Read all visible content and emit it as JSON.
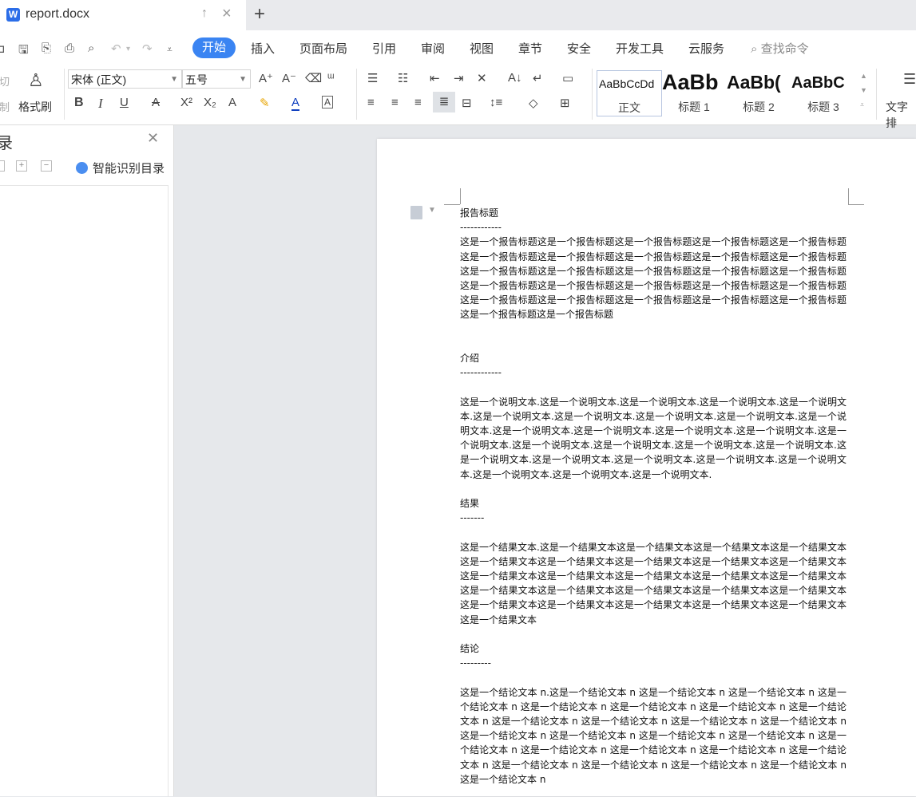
{
  "tab": {
    "app_icon": "W",
    "title": "report.docx",
    "new_tab": "+"
  },
  "menu": {
    "tabs": [
      "开始",
      "插入",
      "页面布局",
      "引用",
      "审阅",
      "视图",
      "章节",
      "安全",
      "开发工具",
      "云服务"
    ],
    "search": "查找命令"
  },
  "ribbon": {
    "cut": "切",
    "copy": "制",
    "format_painter": "格式刷",
    "font_name": "宋体 (正文)",
    "font_size": "五号",
    "styles": [
      {
        "sample": "AaBbCcDd",
        "name": "正文"
      },
      {
        "sample": "AaBb",
        "name": "标题 1"
      },
      {
        "sample": "AaBb(",
        "name": "标题 2"
      },
      {
        "sample": "AaBbC",
        "name": "标题 3"
      }
    ],
    "text_layout": "文字排"
  },
  "nav": {
    "title": "录",
    "smart_toc": "智能识别目录"
  },
  "document": {
    "h1": "报告标题",
    "h1_rule": "------------",
    "p1": "这是一个报告标题这是一个报告标题这是一个报告标题这是一个报告标题这是一个报告标题这是一个报告标题这是一个报告标题这是一个报告标题这是一个报告标题这是一个报告标题这是一个报告标题这是一个报告标题这是一个报告标题这是一个报告标题这是一个报告标题这是一个报告标题这是一个报告标题这是一个报告标题这是一个报告标题这是一个报告标题这是一个报告标题这是一个报告标题这是一个报告标题这是一个报告标题这是一个报告标题这是一个报告标题这是一个报告标题",
    "h2": "介绍",
    "h2_rule": "------------",
    "p2": "这是一个说明文本.这是一个说明文本.这是一个说明文本.这是一个说明文本.这是一个说明文本.这是一个说明文本.这是一个说明文本.这是一个说明文本.这是一个说明文本.这是一个说明文本.这是一个说明文本.这是一个说明文本.这是一个说明文本.这是一个说明文本.这是一个说明文本.这是一个说明文本.这是一个说明文本.这是一个说明文本.这是一个说明文本.这是一个说明文本.这是一个说明文本.这是一个说明文本.这是一个说明文本.这是一个说明文本.这是一个说明文本.这是一个说明文本.这是一个说明文本.",
    "h3": "结果",
    "h3_rule": "-------",
    "p3": "这是一个结果文本.这是一个结果文本这是一个结果文本这是一个结果文本这是一个结果文本这是一个结果文本这是一个结果文本这是一个结果文本这是一个结果文本这是一个结果文本这是一个结果文本这是一个结果文本这是一个结果文本这是一个结果文本这是一个结果文本这是一个结果文本这是一个结果文本这是一个结果文本这是一个结果文本这是一个结果文本这是一个结果文本这是一个结果文本这是一个结果文本这是一个结果文本这是一个结果文本这是一个结果文本",
    "h4": "结论",
    "h4_rule": "---------",
    "p4": "这是一个结论文本 n.这是一个结论文本 n 这是一个结论文本 n 这是一个结论文本 n 这是一个结论文本 n 这是一个结论文本 n 这是一个结论文本 n 这是一个结论文本 n 这是一个结论文本 n 这是一个结论文本 n 这是一个结论文本 n 这是一个结论文本 n 这是一个结论文本 n 这是一个结论文本 n 这是一个结论文本 n 这是一个结论文本 n 这是一个结论文本 n 这是一个结论文本 n 这是一个结论文本 n 这是一个结论文本 n 这是一个结论文本 n 这是一个结论文本 n 这是一个结论文本 n 这是一个结论文本 n 这是一个结论文本 n 这是一个结论文本 n 这是一个结论文本 n"
  }
}
